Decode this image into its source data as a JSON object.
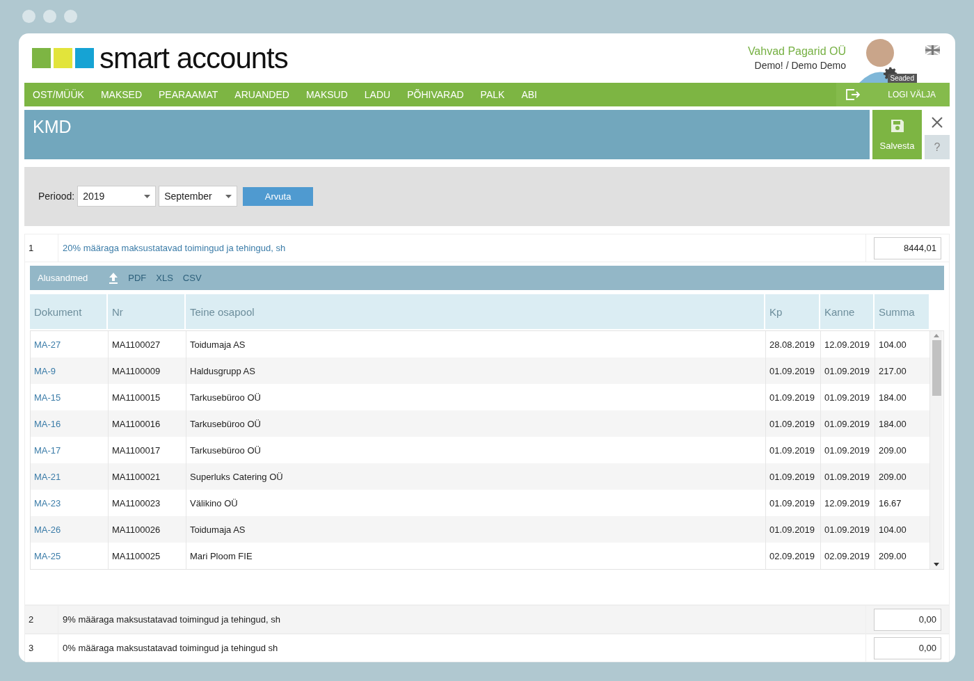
{
  "logo": {
    "text": "smart accounts"
  },
  "company": {
    "name": "Vahvad Pagarid OÜ",
    "user": "Demo! / Demo Demo",
    "settings_label": "Seaded"
  },
  "nav": {
    "items": [
      "OST/MÜÜK",
      "MAKSED",
      "PEARAAMAT",
      "ARUANDED",
      "MAKSUD",
      "LADU",
      "PÕHIVARAD",
      "PALK",
      "ABI"
    ],
    "logout": "LOGI VÄLJA"
  },
  "page": {
    "title": "KMD",
    "save": "Salvesta",
    "help": "?"
  },
  "filter": {
    "label": "Periood:",
    "year": "2019",
    "month": "September",
    "button": "Arvuta"
  },
  "lines": [
    {
      "no": "1",
      "label": "20% määraga maksustatavad toimingud ja tehingud, sh",
      "value": "8444,01",
      "expanded": true
    },
    {
      "no": "2",
      "label": "9% määraga maksustatavad toimingud ja tehingud, sh",
      "value": "0,00",
      "expanded": false
    },
    {
      "no": "3",
      "label": "0% määraga maksustatavad toimingud ja tehingud sh",
      "value": "0,00",
      "expanded": false
    }
  ],
  "details": {
    "title": "Alusandmed",
    "exports": [
      "PDF",
      "XLS",
      "CSV"
    ],
    "columns": [
      "Dokument",
      "Nr",
      "Teine osapool",
      "Kp",
      "Kanne",
      "Summa"
    ],
    "rows": [
      [
        "MA-27",
        "MA1100027",
        "Toidumaja AS",
        "28.08.2019",
        "12.09.2019",
        "104.00"
      ],
      [
        "MA-9",
        "MA1100009",
        "Haldusgrupp AS",
        "01.09.2019",
        "01.09.2019",
        "217.00"
      ],
      [
        "MA-15",
        "MA1100015",
        "Tarkusebüroo OÜ",
        "01.09.2019",
        "01.09.2019",
        "184.00"
      ],
      [
        "MA-16",
        "MA1100016",
        "Tarkusebüroo OÜ",
        "01.09.2019",
        "01.09.2019",
        "184.00"
      ],
      [
        "MA-17",
        "MA1100017",
        "Tarkusebüroo OÜ",
        "01.09.2019",
        "01.09.2019",
        "209.00"
      ],
      [
        "MA-21",
        "MA1100021",
        "Superluks Catering OÜ",
        "01.09.2019",
        "01.09.2019",
        "209.00"
      ],
      [
        "MA-23",
        "MA1100023",
        "Välikino OÜ",
        "01.09.2019",
        "12.09.2019",
        "16.67"
      ],
      [
        "MA-26",
        "MA1100026",
        "Toidumaja AS",
        "01.09.2019",
        "01.09.2019",
        "104.00"
      ],
      [
        "MA-25",
        "MA1100025",
        "Mari Ploom FIE",
        "02.09.2019",
        "02.09.2019",
        "209.00"
      ]
    ]
  }
}
